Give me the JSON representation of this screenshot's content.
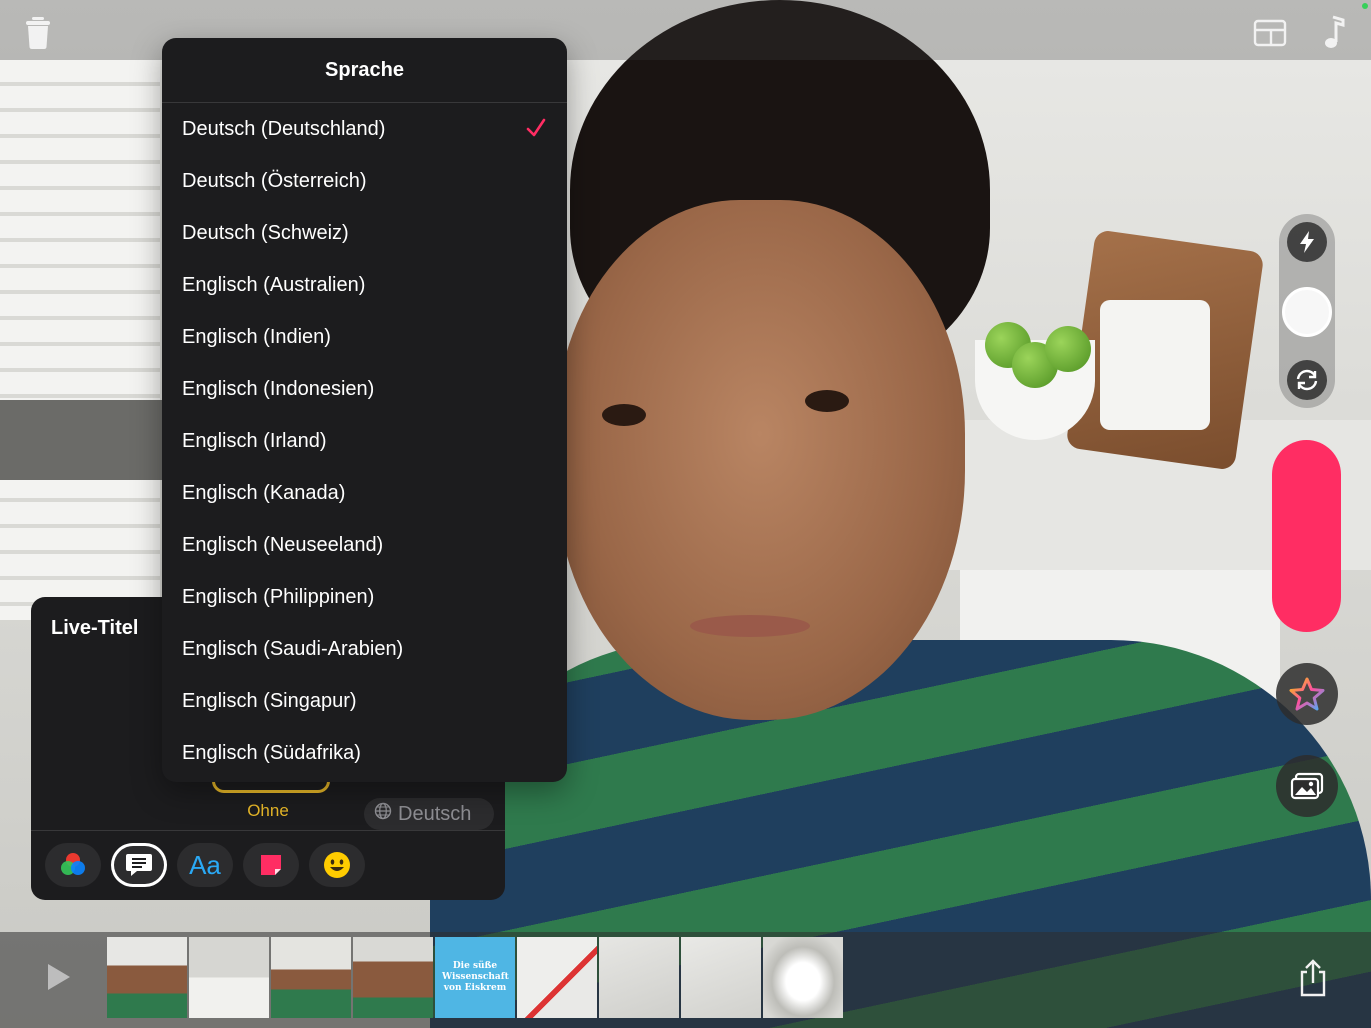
{
  "dropdown": {
    "title": "Sprache",
    "items": [
      {
        "label": "Deutsch (Deutschland)",
        "selected": true
      },
      {
        "label": "Deutsch (Österreich)"
      },
      {
        "label": "Deutsch (Schweiz)"
      },
      {
        "label": "Englisch (Australien)"
      },
      {
        "label": "Englisch (Indien)"
      },
      {
        "label": "Englisch (Indonesien)"
      },
      {
        "label": "Englisch (Irland)"
      },
      {
        "label": "Englisch (Kanada)"
      },
      {
        "label": "Englisch (Neuseeland)"
      },
      {
        "label": "Englisch (Philippinen)"
      },
      {
        "label": "Englisch (Saudi-Arabien)"
      },
      {
        "label": "Englisch (Singapur)"
      },
      {
        "label": "Englisch (Südafrika)"
      }
    ],
    "check_color": "#ff2d63"
  },
  "live_titles": {
    "title": "Live-Titel",
    "style_option": "Ohne",
    "language": "Deutsch",
    "accent_color": "#e8b828",
    "tools": [
      "filters-icon",
      "live-titles-icon",
      "text-icon",
      "stickers-icon",
      "emoji-icon"
    ],
    "text_tool_label": "Aa"
  },
  "timeline": {
    "title_card_text": "Die süße Wissenschaft von Eiskrem"
  },
  "colors": {
    "record": "#ff2d63",
    "panel_bg": "#1c1c1e"
  }
}
